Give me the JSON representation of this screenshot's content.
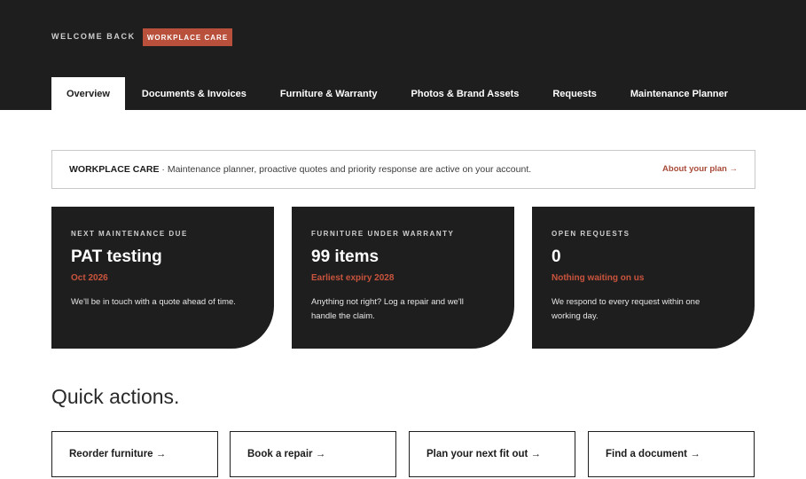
{
  "header": {
    "welcome_text": "WELCOME BACK",
    "plan_badge": "WORKPLACE CARE"
  },
  "tabs": [
    {
      "label": "Overview",
      "active": true
    },
    {
      "label": "Documents & Invoices",
      "active": false
    },
    {
      "label": "Furniture & Warranty",
      "active": false
    },
    {
      "label": "Photos & Brand Assets",
      "active": false
    },
    {
      "label": "Requests",
      "active": false
    },
    {
      "label": "Maintenance Planner",
      "active": false
    }
  ],
  "notice": {
    "title": "WORKPLACE CARE",
    "message": " · Maintenance planner, proactive quotes and priority response are active on your account.",
    "link": "About your plan →"
  },
  "cards": [
    {
      "label": "NEXT MAINTENANCE DUE",
      "value": "PAT testing",
      "sub": "Oct 2026",
      "description": "We'll be in touch with a quote ahead of time."
    },
    {
      "label": "FURNITURE UNDER WARRANTY",
      "value": "99 items",
      "sub": "Earliest expiry 2028",
      "description": "Anything not right? Log a repair and we'll handle the claim."
    },
    {
      "label": "OPEN REQUESTS",
      "value": "0",
      "sub": "Nothing waiting on us",
      "description": "We respond to every request within one working day."
    }
  ],
  "quick_actions": {
    "title": "Quick actions.",
    "items": [
      {
        "label": "Reorder furniture →"
      },
      {
        "label": "Book a repair →"
      },
      {
        "label": "Plan your next fit out →"
      },
      {
        "label": "Find a document →"
      }
    ]
  },
  "colors": {
    "header_bg": "#1f1e1e",
    "accent": "#b8503b",
    "accent_text": "#c9543d"
  }
}
